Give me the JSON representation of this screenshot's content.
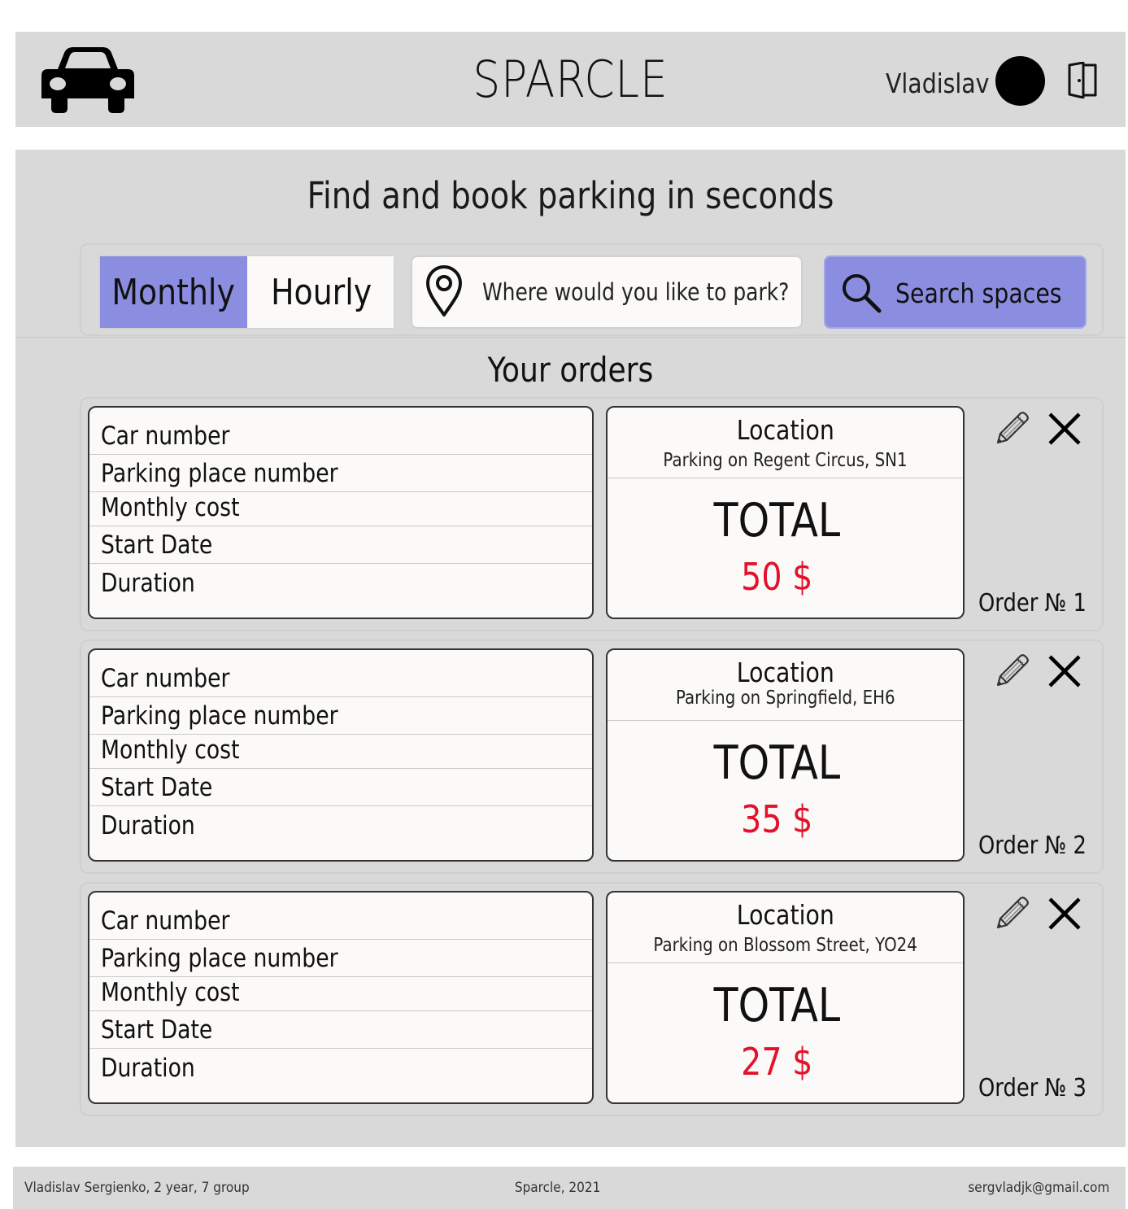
{
  "header": {
    "app_title": "SPARCLE",
    "user_name": "Vladislav",
    "logo_icon": "car-icon",
    "avatar_icon": "avatar",
    "logout_icon": "door-exit-icon"
  },
  "hero": {
    "headline": "Find and book parking in seconds"
  },
  "search": {
    "mode_options": [
      "Monthly",
      "Hourly"
    ],
    "selected_mode": "Monthly",
    "location_placeholder": "Where would you like to park?",
    "location_icon": "map-pin-icon",
    "button_label": "Search spaces",
    "button_icon": "search-icon"
  },
  "orders_section": {
    "title": "Your orders",
    "field_labels": [
      "Car number",
      "Parking place number",
      "Monthly cost",
      "Start Date",
      "Duration"
    ],
    "location_heading": "Location",
    "total_heading": "TOTAL",
    "orders": [
      {
        "location": "Parking on Regent Circus, SN1",
        "total": "50 $",
        "order_label": "Order № 1"
      },
      {
        "location": "Parking on Springfield, EH6",
        "total": "35 $",
        "order_label": "Order № 2"
      },
      {
        "location": "Parking on Blossom Street, YO24",
        "total": "27 $",
        "order_label": "Order № 3"
      }
    ]
  },
  "footer": {
    "author": "Vladislav Sergienko, 2 year, 7 group",
    "copyright": "Sparcle, 2021",
    "email": "sergvladjk@gmail.com"
  },
  "colors": {
    "panel_bg": "#d9d9d9",
    "accent": "#8b8de0",
    "total_red": "#e3122b",
    "card_bg": "#fbfaf8"
  }
}
